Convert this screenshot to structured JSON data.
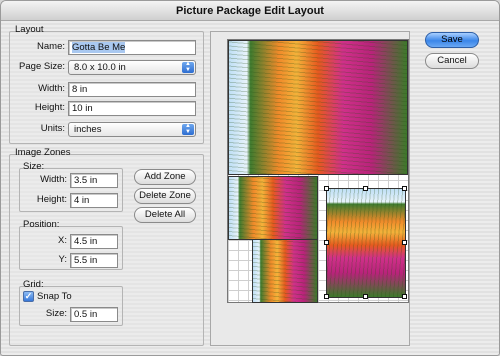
{
  "window": {
    "title": "Picture Package Edit Layout"
  },
  "layout": {
    "group_label": "Layout",
    "name_label": "Name:",
    "name_value": "Gotta Be Me",
    "page_size_label": "Page Size:",
    "page_size_value": "8.0 x 10.0 in",
    "width_label": "Width:",
    "width_value": "8 in",
    "height_label": "Height:",
    "height_value": "10 in",
    "units_label": "Units:",
    "units_value": "inches"
  },
  "image_zones": {
    "group_label": "Image Zones",
    "size_label": "Size:",
    "size_width_label": "Width:",
    "size_width_value": "3.5 in",
    "size_height_label": "Height:",
    "size_height_value": "4 in",
    "position_label": "Position:",
    "x_label": "X:",
    "x_value": "4.5 in",
    "y_label": "Y:",
    "y_value": "5.5 in",
    "add_zone": "Add Zone",
    "delete_zone": "Delete Zone",
    "delete_all": "Delete All"
  },
  "grid": {
    "group_label": "Grid:",
    "snap_to_label": "Snap To",
    "snap_to_checked": true,
    "size_label": "Size:",
    "size_value": "0.5 in"
  },
  "actions": {
    "save": "Save",
    "cancel": "Cancel"
  },
  "icons": {
    "popup_arrows": "updown-arrows-icon",
    "check": "checkmark-icon"
  },
  "colors": {
    "accent": "#3b86e8",
    "selection": "#a9c8f0"
  }
}
